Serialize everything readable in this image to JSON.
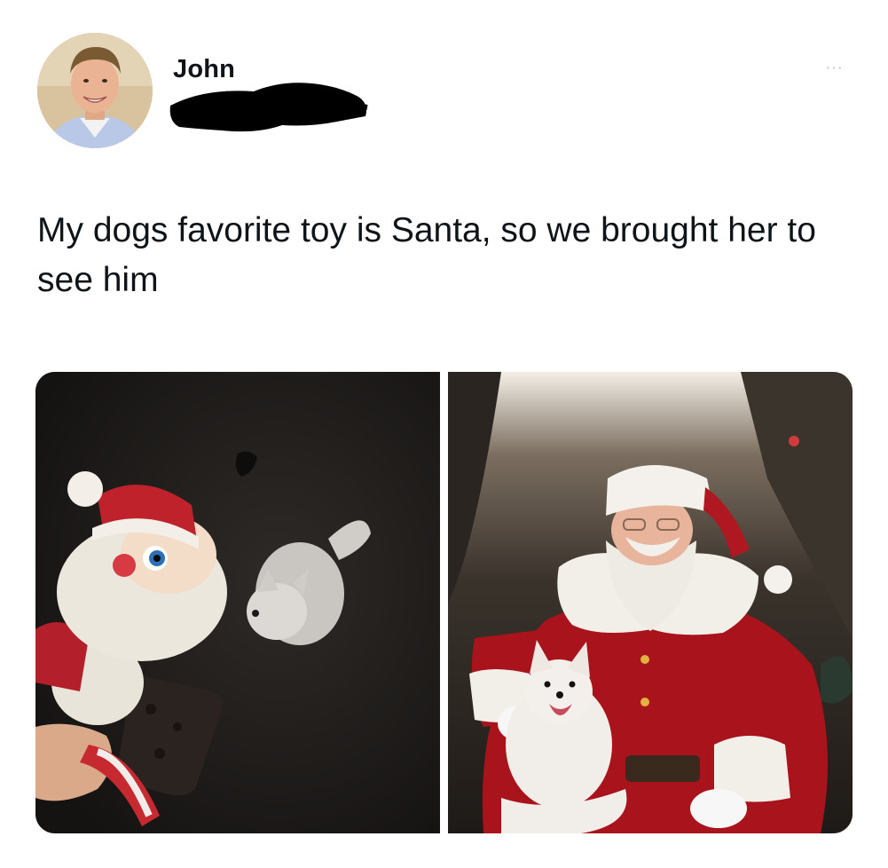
{
  "author": {
    "name": "John",
    "handle_redacted": true
  },
  "tweet": {
    "text": "My dogs favorite toy is Santa, so we brought her to see him"
  },
  "actions": {
    "more_label": "···"
  },
  "icons": {
    "more": "more-horizontal-icon"
  },
  "colors": {
    "text": "#0f1419",
    "muted": "#c5c9ce",
    "background": "#ffffff"
  }
}
